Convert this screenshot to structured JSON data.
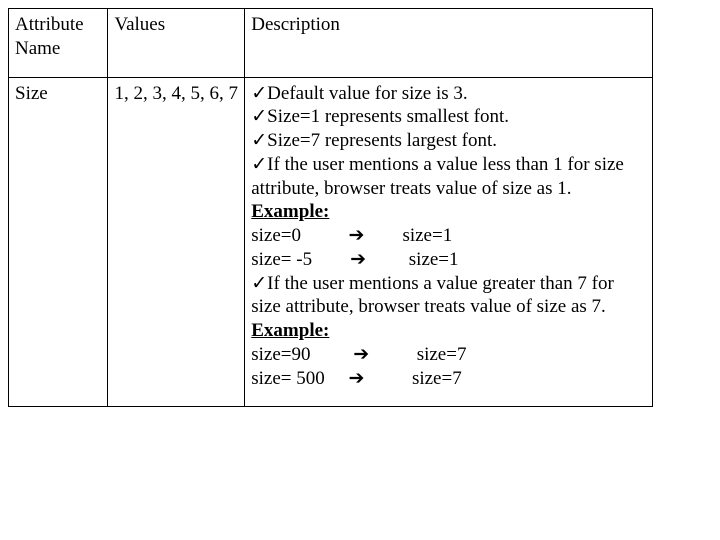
{
  "headers": {
    "attr": "Attribute Name",
    "values": "Values",
    "desc": "Description"
  },
  "row": {
    "attr": "Size",
    "values": "1, 2, 3, 4, 5, 6, 7",
    "bullets": {
      "b1": "Default value for size is 3.",
      "b2": "Size=1 represents smallest font.",
      "b3": "Size=7 represents largest font.",
      "b4": "If the user mentions a value less than 1 for size attribute,  browser treats value of size as 1.",
      "b5": "If the user mentions a value greater than 7 for size attribute,  browser treats value of size as 7."
    },
    "example_label1": "Example:",
    "example_label2": "Example:",
    "map1a_left": "size=0",
    "map1a_right": "size=1",
    "map1b_left": "size= -5",
    "map1b_right": "size=1",
    "map2a_left": "size=90",
    "map2a_right": "size=7",
    "map2b_left": "size= 500",
    "map2b_right": "size=7"
  },
  "glyphs": {
    "check": "✓",
    "arrow": "➔"
  }
}
